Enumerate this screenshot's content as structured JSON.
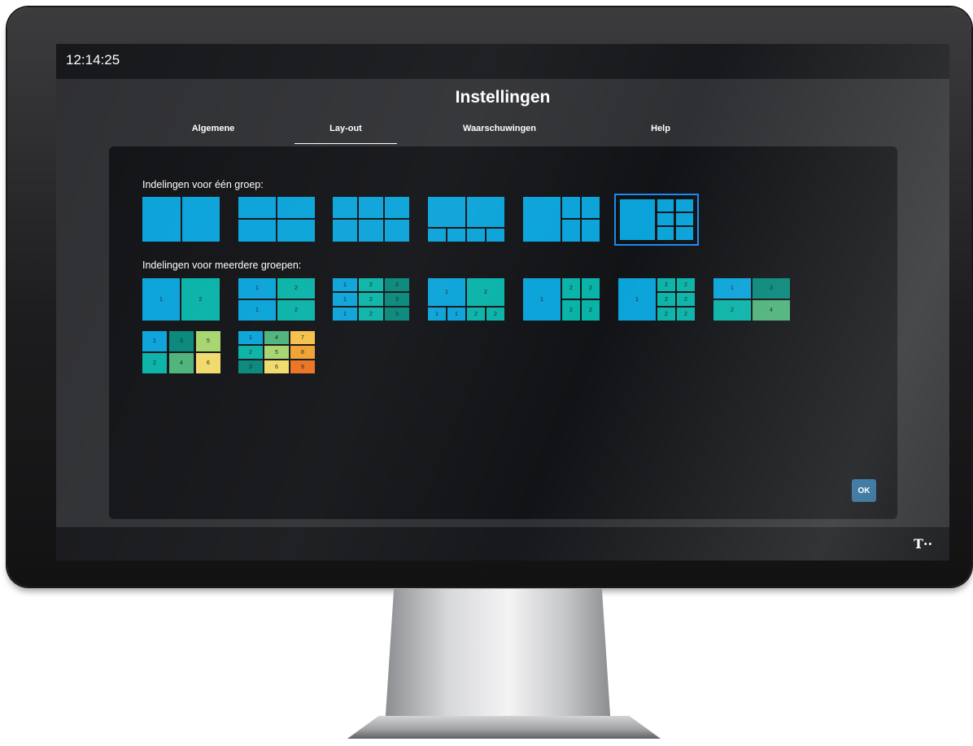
{
  "clock": "12:14:25",
  "title": "Instellingen",
  "tabs": [
    {
      "label": "Algemene",
      "active": false
    },
    {
      "label": "Lay-out",
      "active": true
    },
    {
      "label": "Waarschuwingen",
      "active": false
    },
    {
      "label": "Help",
      "active": false
    }
  ],
  "single_group": {
    "label": "Indelingen voor één groep:",
    "selected_index": 5
  },
  "multi_group": {
    "label": "Indelingen voor meerdere groepen:",
    "layouts": [
      {
        "cells": [
          {
            "n": "1",
            "c": "#0aa3d9"
          },
          {
            "n": "2",
            "c": "#09b3a8"
          }
        ]
      },
      {
        "cells": [
          {
            "n": "1",
            "c": "#0aa3d9"
          },
          {
            "n": "2",
            "c": "#09b3a8"
          },
          {
            "n": "1",
            "c": "#0aa3d9"
          },
          {
            "n": "2",
            "c": "#09b3a8"
          }
        ]
      },
      {
        "cells": [
          {
            "n": "1",
            "c": "#0aa3d9"
          },
          {
            "n": "2",
            "c": "#09b3a8"
          },
          {
            "n": "3",
            "c": "#07877a"
          },
          {
            "n": "1",
            "c": "#0aa3d9"
          },
          {
            "n": "2",
            "c": "#09b3a8"
          },
          {
            "n": "3",
            "c": "#07877a"
          },
          {
            "n": "1",
            "c": "#0aa3d9"
          },
          {
            "n": "2",
            "c": "#09b3a8"
          },
          {
            "n": "3",
            "c": "#07877a"
          }
        ]
      },
      {
        "cells": [
          {
            "n": "1",
            "c": "#0aa3d9"
          },
          {
            "n": "2",
            "c": "#09b3a8"
          },
          {
            "n": "1",
            "c": "#0aa3d9"
          },
          {
            "n": "1",
            "c": "#0aa3d9"
          },
          {
            "n": "2",
            "c": "#09b3a8"
          },
          {
            "n": "2",
            "c": "#09b3a8"
          }
        ]
      },
      {
        "cells": [
          {
            "n": "1",
            "c": "#0aa3d9"
          },
          {
            "n": "2",
            "c": "#09b3a8"
          },
          {
            "n": "2",
            "c": "#09b3a8"
          },
          {
            "n": "2",
            "c": "#09b3a8"
          },
          {
            "n": "2",
            "c": "#09b3a8"
          }
        ]
      },
      {
        "cells": [
          {
            "n": "1",
            "c": "#0aa3d9"
          },
          {
            "n": "2",
            "c": "#09b3a8"
          },
          {
            "n": "2",
            "c": "#09b3a8"
          },
          {
            "n": "2",
            "c": "#09b3a8"
          },
          {
            "n": "2",
            "c": "#09b3a8"
          },
          {
            "n": "2",
            "c": "#09b3a8"
          },
          {
            "n": "2",
            "c": "#09b3a8"
          }
        ]
      },
      {
        "cells": [
          {
            "n": "1",
            "c": "#0aa3d9"
          },
          {
            "n": "3",
            "c": "#07877a"
          },
          {
            "n": "2",
            "c": "#09b3a8"
          },
          {
            "n": "4",
            "c": "#4db27a"
          }
        ]
      },
      {
        "cells": [
          {
            "n": "1",
            "c": "#0aa3d9"
          },
          {
            "n": "3",
            "c": "#07877a"
          },
          {
            "n": "5",
            "c": "#a6d56f"
          },
          {
            "n": "2",
            "c": "#09b3a8"
          },
          {
            "n": "4",
            "c": "#4db27a"
          },
          {
            "n": "6",
            "c": "#f2da6a"
          }
        ]
      },
      {
        "cells": [
          {
            "n": "1",
            "c": "#0aa3d9"
          },
          {
            "n": "4",
            "c": "#4db27a"
          },
          {
            "n": "7",
            "c": "#f5c04a"
          },
          {
            "n": "2",
            "c": "#09b3a8"
          },
          {
            "n": "5",
            "c": "#a6d56f"
          },
          {
            "n": "8",
            "c": "#f0a030"
          },
          {
            "n": "3",
            "c": "#07877a"
          },
          {
            "n": "6",
            "c": "#f2da6a"
          },
          {
            "n": "9",
            "c": "#ea7220"
          }
        ]
      }
    ]
  },
  "ok_label": "OK",
  "logo": "T··"
}
